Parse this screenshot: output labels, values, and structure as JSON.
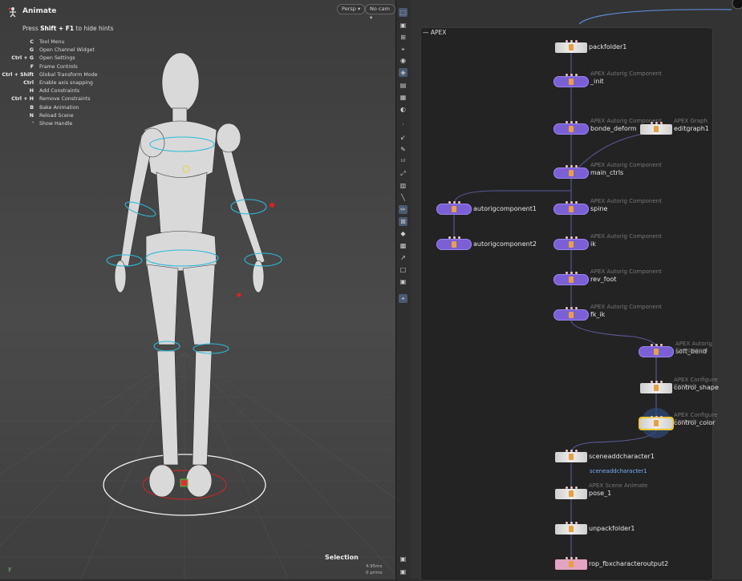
{
  "viewport": {
    "title": "Animate",
    "hint_prefix": "Press ",
    "hint_key": "Shift + F1",
    "hint_suffix": " to hide hints",
    "camera_button": "Persp",
    "cam_button": "No cam",
    "hotkeys": [
      {
        "key": "C",
        "desc": "Tool Menu"
      },
      {
        "key": "G",
        "desc": "Open Channel Widget"
      },
      {
        "key": "Ctrl + G",
        "desc": "Open Settings"
      },
      {
        "key": "F",
        "desc": "Frame Controls"
      },
      {
        "key": "Ctrl + Shift",
        "desc": "Global Transform Mode"
      },
      {
        "key": "Ctrl",
        "desc": "Enable axis snapping"
      },
      {
        "key": "H",
        "desc": "Add Constraints"
      },
      {
        "key": "Ctrl + H",
        "desc": "Remove Constraints"
      },
      {
        "key": "B",
        "desc": "Bake Animation"
      },
      {
        "key": "N",
        "desc": "Reload Scene"
      },
      {
        "key": "'",
        "desc": "Show Handle"
      }
    ],
    "selection_label": "Selection",
    "stats_line1": "4.95ms",
    "stats_line2": "0  prims",
    "axis_label": "y"
  },
  "network": {
    "title": "APEX",
    "nodes": [
      {
        "name": "packfolder1",
        "type": "",
        "kind": "box"
      },
      {
        "name": "_init",
        "type": "APEX Autorig Component",
        "kind": "pill"
      },
      {
        "name": "bonde_deform",
        "type": "APEX Autorig Component",
        "kind": "pill"
      },
      {
        "name": "editgraph1",
        "type": "APEX Graph",
        "kind": "box"
      },
      {
        "name": "main_ctrls",
        "type": "APEX Autorig Component",
        "kind": "pill"
      },
      {
        "name": "autorigcomponent1",
        "type": "",
        "kind": "pill"
      },
      {
        "name": "spine",
        "type": "APEX Autorig Component",
        "kind": "pill"
      },
      {
        "name": "autorigcomponent2",
        "type": "",
        "kind": "pill"
      },
      {
        "name": "ik",
        "type": "APEX Autorig Component",
        "kind": "pill"
      },
      {
        "name": "rev_foot",
        "type": "APEX Autorig Component",
        "kind": "pill"
      },
      {
        "name": "fk_ik",
        "type": "APEX Autorig Component",
        "kind": "pill"
      },
      {
        "name": "soft_bend",
        "type": "APEX Autorig Component",
        "kind": "pill"
      },
      {
        "name": "control_shape",
        "type": "APEX Configure Controls",
        "kind": "box"
      },
      {
        "name": "control_color",
        "type": "APEX Configure Controls",
        "kind": "box"
      },
      {
        "name": "sceneaddcharacter1",
        "type": "",
        "kind": "box"
      },
      {
        "name": "pose_1",
        "type": "APEX Scene Animate",
        "kind": "box"
      },
      {
        "name": "unpackfolder1",
        "type": "",
        "kind": "box"
      },
      {
        "name": "rop_fbxcharacteroutput2",
        "type": "",
        "kind": "pink"
      }
    ],
    "link_label": "sceneaddcharacter1"
  },
  "colors": {
    "pill": "#7b5fd6",
    "box": "#d8d8d8",
    "pink": "#e3a3c3",
    "wire": "#5a5a9a",
    "selected": "#f2c92b"
  }
}
